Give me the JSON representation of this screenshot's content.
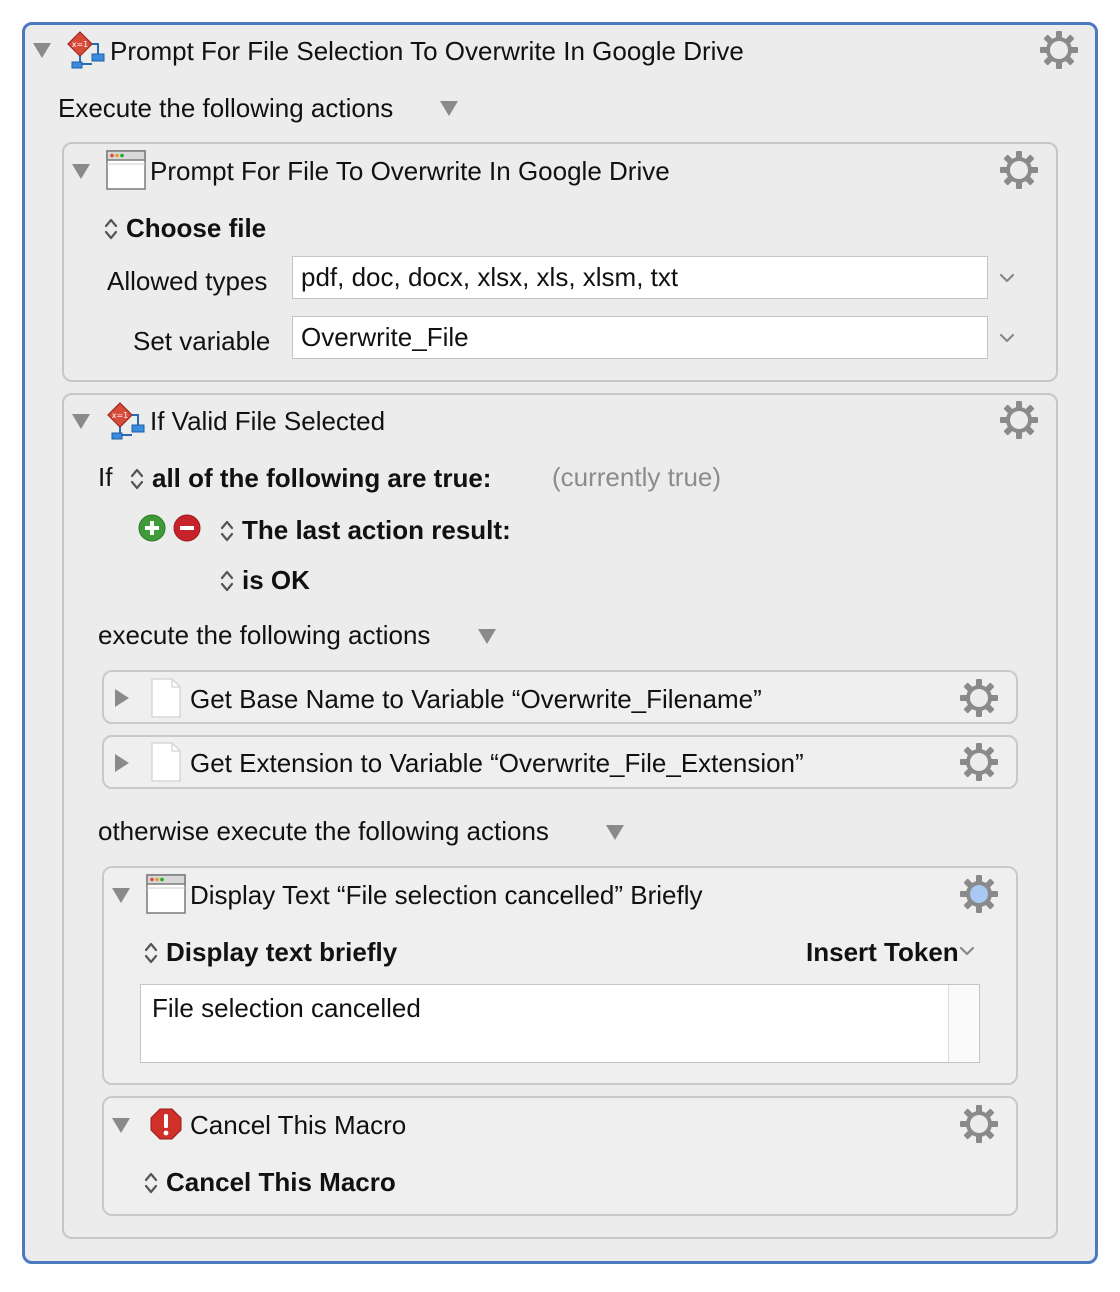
{
  "macro": {
    "title": "Prompt For File Selection To Overwrite In Google Drive",
    "execute_label": "Execute the following actions"
  },
  "prompt_action": {
    "title": "Prompt For File To Overwrite In Google Drive",
    "mode": "Choose file",
    "allowed_types_label": "Allowed types",
    "allowed_types_value": "pdf, doc, docx, xlsx, xls, xlsm, txt",
    "set_variable_label": "Set variable",
    "set_variable_value": "Overwrite_File"
  },
  "if_action": {
    "title": "If Valid File Selected",
    "if_label": "If",
    "condition_mode": "all of the following are true:",
    "status": "(currently true)",
    "condition_type": "The last action result:",
    "condition_value": "is OK",
    "then_label": "execute the following actions",
    "else_label": "otherwise execute the following actions"
  },
  "then_actions": [
    {
      "title": "Get Base Name to Variable “Overwrite_Filename”"
    },
    {
      "title": "Get Extension to Variable “Overwrite_File_Extension”"
    }
  ],
  "display_action": {
    "title": "Display Text “File selection cancelled” Briefly",
    "mode": "Display text briefly",
    "insert_token_label": "Insert Token",
    "text_value": "File selection cancelled"
  },
  "cancel_action": {
    "title": "Cancel This Macro",
    "mode": "Cancel This Macro"
  },
  "colors": {
    "selection_border": "#4a7ac0",
    "panel_bg": "#ececec",
    "add_green": "#3f9a3a",
    "remove_red": "#c8222a"
  }
}
